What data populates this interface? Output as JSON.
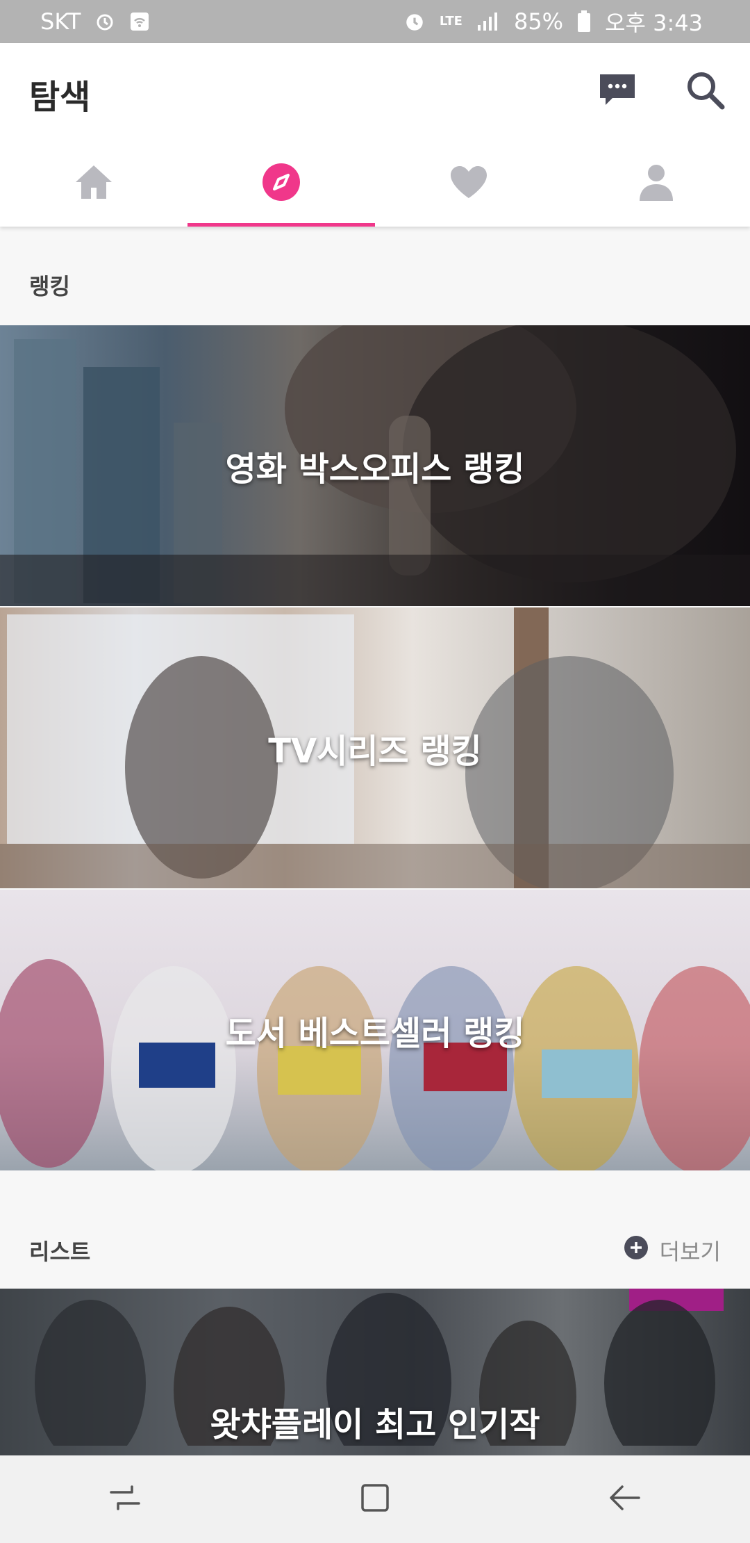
{
  "status_bar": {
    "carrier": "SKT",
    "network": "LTE",
    "battery": "85%",
    "time": "오후 3:43",
    "icons": [
      "alarm-icon",
      "wifi-icon",
      "alarm-icon",
      "signal-icon",
      "battery-icon"
    ]
  },
  "header": {
    "title": "탐색",
    "actions": [
      "chat-icon",
      "search-icon"
    ]
  },
  "tabs": [
    {
      "name": "home",
      "icon": "home-icon",
      "active": false
    },
    {
      "name": "explore",
      "icon": "compass-icon",
      "active": true
    },
    {
      "name": "favorites",
      "icon": "heart-icon",
      "active": false
    },
    {
      "name": "profile",
      "icon": "person-icon",
      "active": false
    }
  ],
  "ranking": {
    "title": "랭킹",
    "banners": [
      {
        "label": "영화 박스오피스 랭킹"
      },
      {
        "label": "TV시리즈 랭킹"
      },
      {
        "label": "도서 베스트셀러 랭킹"
      }
    ]
  },
  "list": {
    "title": "리스트",
    "more_label": "더보기",
    "banners": [
      {
        "label": "왓챠플레이 최고 인기작"
      }
    ]
  },
  "nav_bar": [
    "recent-apps-icon",
    "home-square-icon",
    "back-icon"
  ],
  "colors": {
    "accent": "#f0378a",
    "icon_inactive": "#b9b9bf",
    "dark_icon": "#4b4c5a"
  }
}
